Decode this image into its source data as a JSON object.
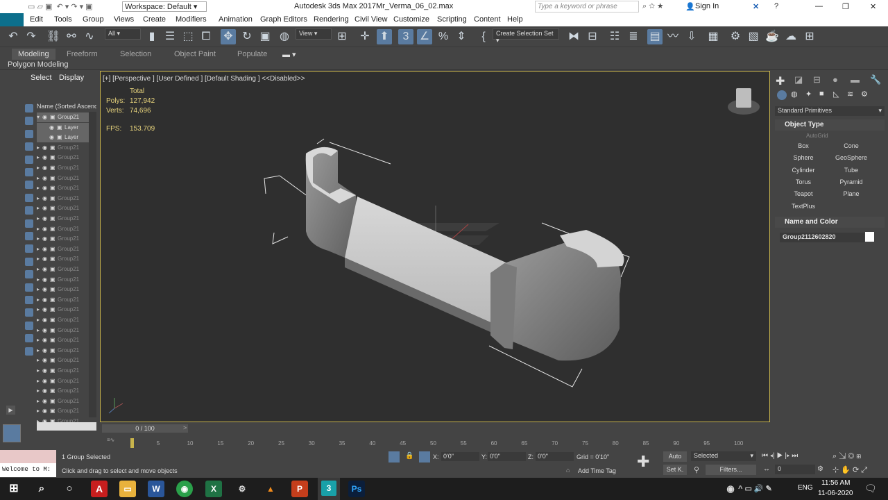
{
  "app": {
    "logo_label": "3",
    "title": "Autodesk 3ds Max 2017",
    "file": "Mr_Verma_06_02.max",
    "workspace": "Workspace: Default",
    "search_placeholder": "Type a keyword or phrase",
    "sign_in": "Sign In"
  },
  "menu": [
    "Edit",
    "Tools",
    "Group",
    "Views",
    "Create",
    "Modifiers",
    "Animation",
    "Graph Editors",
    "Rendering",
    "Civil View",
    "Customize",
    "Scripting",
    "Content",
    "Help"
  ],
  "toolbar": {
    "filter": "All",
    "view": "View",
    "selection_set": "Create Selection Set"
  },
  "ribbon": {
    "tabs": [
      "Modeling",
      "Freeform",
      "Selection",
      "Object Paint",
      "Populate"
    ],
    "polygon_modeling": "Polygon Modeling"
  },
  "scene": {
    "tab_select": "Select",
    "tab_display": "Display",
    "column_header": "Name (Sorted Ascendi",
    "rows": [
      {
        "name": "Group21",
        "type": "group",
        "selected": true
      },
      {
        "name": "Layer",
        "type": "child",
        "selected": true
      },
      {
        "name": "Layer",
        "type": "child",
        "selected": true
      },
      {
        "name": "Group21"
      },
      {
        "name": "Group21"
      },
      {
        "name": "Group21"
      },
      {
        "name": "Group21"
      },
      {
        "name": "Group21"
      },
      {
        "name": "Group21"
      },
      {
        "name": "Group21"
      },
      {
        "name": "Group21"
      },
      {
        "name": "Group21"
      },
      {
        "name": "Group21"
      },
      {
        "name": "Group21"
      },
      {
        "name": "Group21"
      },
      {
        "name": "Group21"
      },
      {
        "name": "Group21"
      },
      {
        "name": "Group21"
      },
      {
        "name": "Group21"
      },
      {
        "name": "Group21"
      },
      {
        "name": "Group21"
      },
      {
        "name": "Group21"
      },
      {
        "name": "Group21"
      },
      {
        "name": "Group21"
      },
      {
        "name": "Group21"
      },
      {
        "name": "Group21"
      },
      {
        "name": "Group21"
      },
      {
        "name": "Group21"
      },
      {
        "name": "Group21"
      },
      {
        "name": "Group21"
      },
      {
        "name": "Group21"
      }
    ]
  },
  "viewport": {
    "label": "[+] [Perspective ] [User Defined ] [Default Shading ]  <<Disabled>>",
    "stats": {
      "total_label": "Total",
      "polys_label": "Polys:",
      "polys": "127,942",
      "verts_label": "Verts:",
      "verts": "74,696",
      "fps_label": "FPS:",
      "fps": "153.709"
    }
  },
  "command_panel": {
    "category": "Standard Primitives",
    "object_type": "Object Type",
    "autogrid": "AutoGrid",
    "buttons": [
      "Box",
      "Cone",
      "Sphere",
      "GeoSphere",
      "Cylinder",
      "Tube",
      "Torus",
      "Pyramid",
      "Teapot",
      "Plane",
      "TextPlus"
    ],
    "name_and_color": "Name and Color",
    "object_name": "Group2112602820"
  },
  "timeline": {
    "frame": "0 / 100",
    "ticks": [
      "5",
      "10",
      "15",
      "20",
      "25",
      "30",
      "35",
      "40",
      "45",
      "50",
      "55",
      "60",
      "65",
      "70",
      "75",
      "80",
      "85",
      "90",
      "95",
      "100"
    ]
  },
  "status": {
    "maxscript": "Welcome to M:",
    "selected": "1 Group Selected",
    "prompt": "Click and drag to select and move objects",
    "x_label": "X:",
    "x": "0'0\"",
    "y_label": "Y:",
    "y": "0'0\"",
    "z_label": "Z:",
    "z": "0'0\"",
    "grid": "Grid = 0'10\"",
    "add_time_tag": "Add Time Tag",
    "auto": "Auto",
    "set_key": "Set K.",
    "key_mode": "Selected",
    "filters": "Filters...",
    "frame_field": "0"
  },
  "taskbar": {
    "time": "11:56 AM",
    "date": "11-06-2020",
    "lang": "ENG"
  }
}
